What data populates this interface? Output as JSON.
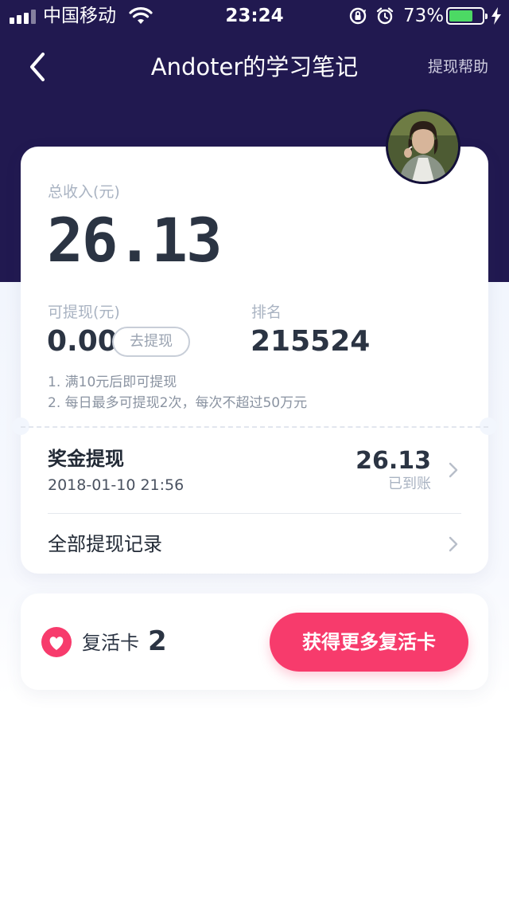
{
  "status_bar": {
    "carrier": "中国移动",
    "time": "23:24",
    "battery_percent": "73%",
    "battery_level": 0.73,
    "signal_bars": 4,
    "signal_active": 3
  },
  "nav": {
    "title": "Andoter的学习笔记",
    "help_label": "提现帮助"
  },
  "summary": {
    "total_income_label": "总收入(元)",
    "total_income": "26.13",
    "withdrawable_label": "可提现(元)",
    "withdrawable": "0.00",
    "withdraw_button": "去提现",
    "rank_label": "排名",
    "rank": "215524",
    "rules": [
      "1. 满10元后即可提现",
      "2. 每日最多可提现2次，每次不超过50万元"
    ]
  },
  "records": {
    "latest": {
      "title": "奖金提现",
      "datetime": "2018-01-10 21:56",
      "amount": "26.13",
      "status": "已到账"
    },
    "all_label": "全部提现记录"
  },
  "revive": {
    "label": "复活卡",
    "count": "2",
    "button": "获得更多复活卡"
  },
  "colors": {
    "header_bg": "#211950",
    "accent": "#f73b6c",
    "battery_green": "#4cd964"
  }
}
